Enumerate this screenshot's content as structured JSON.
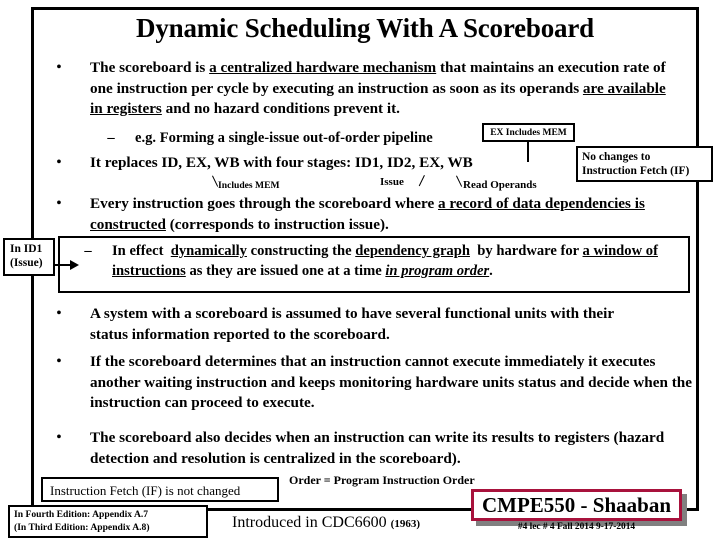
{
  "slide": {
    "title": "Dynamic Scheduling With A Scoreboard",
    "bullets": [
      {
        "id": "scoreboard-definition",
        "segments": [
          {
            "text": "The scoreboard is ",
            "style": "plain"
          },
          {
            "text": "a centralized hardware mechanism",
            "style": "underline"
          },
          {
            "text": " that maintains an execution rate of one instruction per cycle by executing an instruction as soon as its operands ",
            "style": "plain"
          },
          {
            "text": "are available in registers",
            "style": "underline"
          },
          {
            "text": " and no hazard conditions prevent it.",
            "style": "plain"
          }
        ],
        "plain": "The scoreboard is a centralized hardware mechanism that maintains an execution rate of one instruction per cycle by executing an instruction as soon as its operands are available in registers and no hazard conditions prevent it."
      },
      {
        "id": "replaces-stages",
        "segments": [
          {
            "text": "It replaces ID, EX, WB with four stages:  ID1, ID2, EX, WB",
            "style": "plain"
          }
        ],
        "plain": "It replaces ID, EX, WB with four stages:  ID1, ID2, EX, WB"
      },
      {
        "id": "record-of-data-dependencies",
        "segments": [
          {
            "text": "Every instruction goes through the scoreboard where ",
            "style": "plain"
          },
          {
            "text": "a record of data dependencies is constructed",
            "style": "underline"
          },
          {
            "text": " (corresponds to instruction issue).",
            "style": "plain"
          }
        ],
        "plain": "Every instruction goes through the scoreboard where a record of data dependencies is constructed (corresponds to instruction issue)."
      },
      {
        "id": "functional-units-status",
        "segments": [
          {
            "text": "A system with a scoreboard is assumed to have several functional units with their status information reported to the scoreboard.",
            "style": "plain"
          }
        ],
        "plain": "A system with a scoreboard is assumed to have several functional units with their status information reported to the scoreboard."
      },
      {
        "id": "cannot-execute-immediately",
        "segments": [
          {
            "text": "If the scoreboard determines that an instruction cannot execute immediately it executes another waiting instruction and keeps monitoring hardware units status and decide when the instruction can  proceed to execute.",
            "style": "plain"
          }
        ],
        "plain": "If the scoreboard determines that an instruction cannot execute immediately it executes another waiting instruction and keeps monitoring hardware units status and decide when the instruction can  proceed to execute."
      },
      {
        "id": "write-results-to-registers",
        "segments": [
          {
            "text": "The scoreboard also decides when an instruction can write its results to registers (hazard detection and resolution is centralized in the scoreboard).",
            "style": "plain"
          }
        ],
        "plain": "The scoreboard also decides when an instruction can write its results to registers (hazard detection and resolution is centralized in the scoreboard)."
      }
    ],
    "sub_bullets": [
      {
        "id": "single-issue-pipeline",
        "plain": "e.g. Forming a single-issue out-of-order pipeline",
        "segments": [
          {
            "text": "e.g. Forming a single-issue out-of-order pipeline",
            "style": "plain"
          }
        ]
      },
      {
        "id": "dependency-graph",
        "plain": "In effect  dynamically constructing the dependency graph  by hardware for a window of instructions as they are issued one at a time in program order.",
        "segments": [
          {
            "text": "In effect  ",
            "style": "plain"
          },
          {
            "text": "dynamically",
            "style": "underline"
          },
          {
            "text": " constructing the ",
            "style": "plain"
          },
          {
            "text": "dependency graph",
            "style": "underline"
          },
          {
            "text": "  by hardware for ",
            "style": "plain"
          },
          {
            "text": "a window of instructions",
            "style": "underline"
          },
          {
            "text": " as they are issued one at a time ",
            "style": "plain"
          },
          {
            "text": "in program order",
            "style": "bold-italic-underline"
          },
          {
            "text": ".",
            "style": "plain"
          }
        ]
      }
    ],
    "callouts": {
      "ex_includes_mem": "EX Includes MEM",
      "no_changes_if": "No changes to\nInstruction Fetch (IF)",
      "no_changes_if_line1": "No changes to",
      "no_changes_if_line2": "Instruction Fetch (IF)",
      "in_id1_line1": "In ID1",
      "in_id1_line2": "(Issue)"
    },
    "stage_labels": {
      "includes_mem": "Includes MEM",
      "issue": "Issue",
      "read_operands": "Read Operands"
    },
    "footer": {
      "if_not_changed": "Instruction Fetch (IF) is not changed",
      "order_note": "Order = Program Instruction Order",
      "edition_line1": "In Fourth Edition: Appendix A.7",
      "edition_line2": "(In Third Edition: Appendix A.8)",
      "introduced_label": "Introduced in CDC6600",
      "introduced_year": "(1963)",
      "course_brand": "CMPE550 - Shaaban",
      "lecture_meta": "#4   lec # 4 Fall 2014   9-17-2014"
    },
    "colors": {
      "brand_border": "#A8123C",
      "brand_shadow": "#808080",
      "frame": "#000000",
      "background": "#FFFFFF"
    }
  }
}
